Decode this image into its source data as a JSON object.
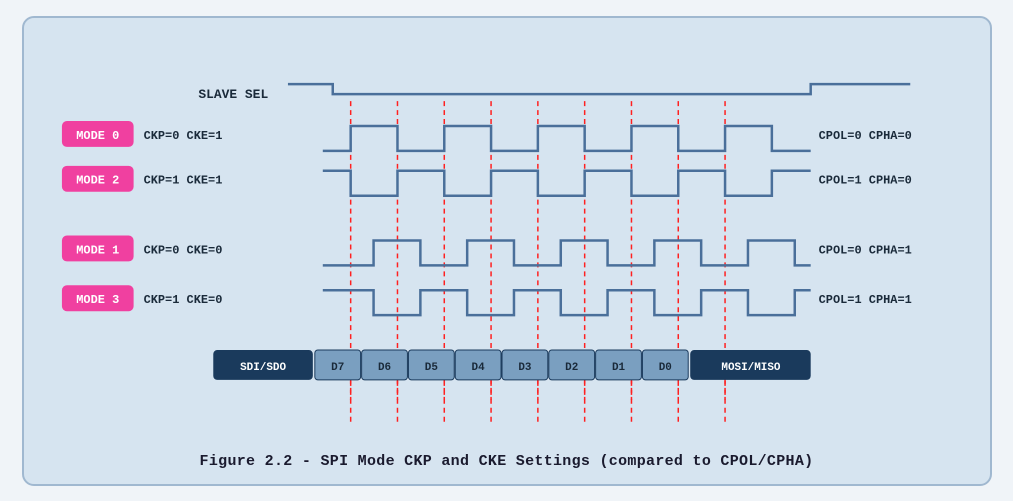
{
  "caption": "Figure 2.2 - SPI Mode CKP and CKE Settings (compared to CPOL/CPHA)",
  "diagram": {
    "slave_sel_label": "SLAVE SEL",
    "modes": [
      {
        "label": "MODE 0",
        "params": "CKP=0  CKE=1",
        "right_params": "CPOL=0  CPHA=0"
      },
      {
        "label": "MODE 2",
        "params": "CKP=1  CKE=1",
        "right_params": "CPOL=1  CPHA=0"
      },
      {
        "label": "MODE 1",
        "params": "CKP=0  CKE=0",
        "right_params": "CPOL=0  CPHA=1"
      },
      {
        "label": "MODE 3",
        "params": "CKP=1  CKE=0",
        "right_params": "CPOL=1  CPHA=1"
      }
    ],
    "data_bits": [
      "SDI/SDO",
      "D7",
      "D6",
      "D5",
      "D4",
      "D3",
      "D2",
      "D1",
      "D0",
      "MOSI/MISO"
    ]
  }
}
